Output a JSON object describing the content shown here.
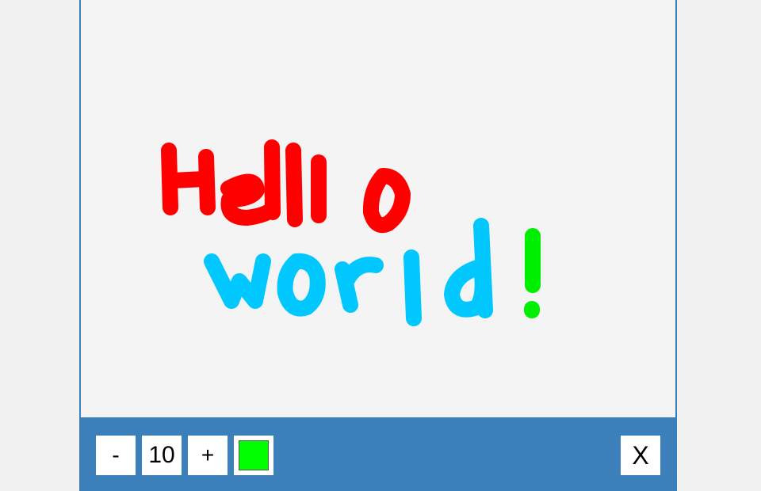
{
  "toolbar": {
    "minus_label": "-",
    "brush_size": "10",
    "plus_label": "+",
    "close_label": "X",
    "current_color": "#00ff00"
  },
  "drawing": {
    "strokes": [
      {
        "word": "Hello",
        "color": "#ff0000"
      },
      {
        "word": "world",
        "color": "#00c8ff"
      },
      {
        "word": "!",
        "color": "#00ee00"
      }
    ]
  },
  "colors": {
    "toolbar_bg": "#3b80bb",
    "canvas_bg": "#f4f4f4"
  }
}
